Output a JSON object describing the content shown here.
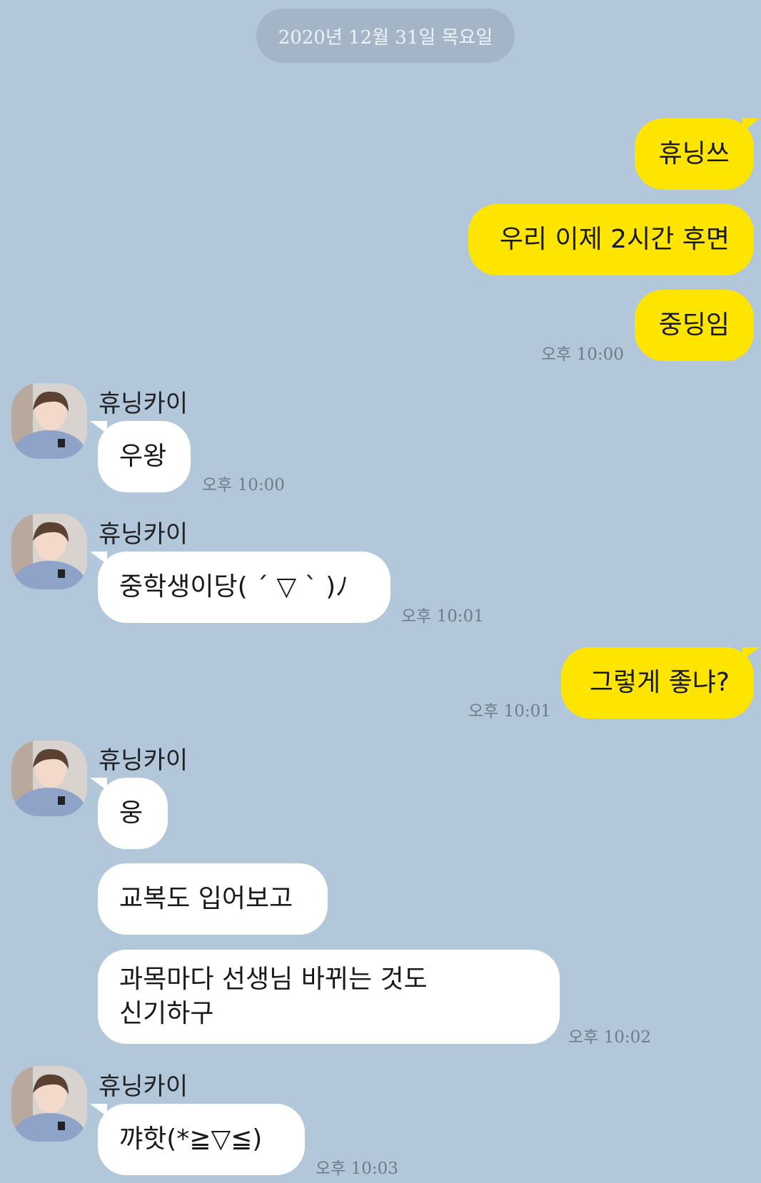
{
  "date_divider": "2020년 12월 31일 목요일",
  "sender_name": "휴닝카이",
  "messages": [
    {
      "text": "휴닝쓰"
    },
    {
      "text": "우리 이제 2시간 후면"
    },
    {
      "text": "중딩임",
      "time": "오후 10:00"
    },
    {
      "text": "우왕",
      "time": "오후 10:00"
    },
    {
      "text": "중학생이당( ´ ▽ ` )ﾉ",
      "time": "오후 10:01"
    },
    {
      "text": "그렇게 좋냐?",
      "time": "오후 10:01"
    },
    {
      "text": "웅"
    },
    {
      "text": "교복도 입어보고"
    },
    {
      "line1": "과목마다 선생님 바뀌는 것도",
      "line2": "신기하구",
      "time": "오후 10:02"
    },
    {
      "text": "꺄핫(*≧▽≦)",
      "time": "오후 10:03"
    }
  ],
  "colors": {
    "background": "#b2c7da",
    "my_bubble": "#fee500",
    "their_bubble": "#ffffff"
  },
  "icons": {
    "avatar": "profile-photo"
  }
}
